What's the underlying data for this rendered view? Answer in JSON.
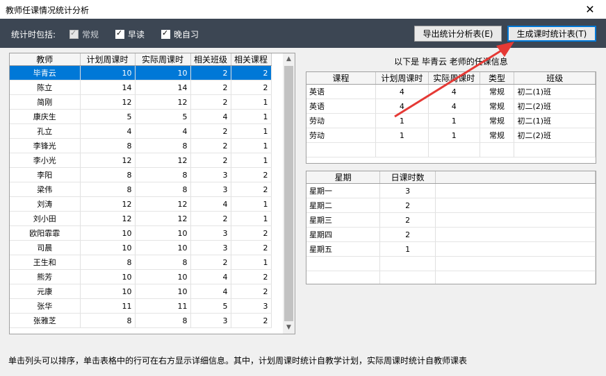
{
  "window": {
    "title": "教师任课情况统计分析",
    "close_glyph": "✕"
  },
  "toolbar": {
    "label": "统计时包括:",
    "checkboxes": [
      {
        "label": "常规",
        "checked": true,
        "disabled": true
      },
      {
        "label": "早读",
        "checked": true,
        "disabled": false
      },
      {
        "label": "晚自习",
        "checked": true,
        "disabled": false
      }
    ],
    "export_button": "导出统计分析表(E)",
    "generate_button": "生成课时统计表(T)"
  },
  "teacher_table": {
    "columns": [
      "教师",
      "计划周课时",
      "实际周课时",
      "相关班级",
      "相关课程"
    ],
    "selected_index": 0,
    "rows": [
      [
        "毕青云",
        "10",
        "10",
        "2",
        "2"
      ],
      [
        "陈立",
        "14",
        "14",
        "2",
        "2"
      ],
      [
        "简刚",
        "12",
        "12",
        "2",
        "1"
      ],
      [
        "康庆生",
        "5",
        "5",
        "4",
        "1"
      ],
      [
        "孔立",
        "4",
        "4",
        "2",
        "1"
      ],
      [
        "李锋光",
        "8",
        "8",
        "2",
        "1"
      ],
      [
        "李小光",
        "12",
        "12",
        "2",
        "1"
      ],
      [
        "李阳",
        "8",
        "8",
        "3",
        "2"
      ],
      [
        "梁伟",
        "8",
        "8",
        "3",
        "2"
      ],
      [
        "刘涛",
        "12",
        "12",
        "4",
        "1"
      ],
      [
        "刘小田",
        "12",
        "12",
        "2",
        "1"
      ],
      [
        "欧阳霏霏",
        "10",
        "10",
        "3",
        "2"
      ],
      [
        "司晨",
        "10",
        "10",
        "3",
        "2"
      ],
      [
        "王生和",
        "8",
        "8",
        "2",
        "1"
      ],
      [
        "熊芳",
        "10",
        "10",
        "4",
        "2"
      ],
      [
        "元康",
        "10",
        "10",
        "4",
        "2"
      ],
      [
        "张华",
        "11",
        "11",
        "5",
        "3"
      ],
      [
        "张雅芝",
        "8",
        "8",
        "3",
        "2"
      ]
    ]
  },
  "detail": {
    "caption": "以下是 毕青云 老师的任课信息",
    "course_columns": [
      "课程",
      "计划周课时",
      "实际周课时",
      "类型",
      "班级"
    ],
    "course_rows": [
      [
        "英语",
        "4",
        "4",
        "常规",
        "初二(1)班"
      ],
      [
        "英语",
        "4",
        "4",
        "常规",
        "初二(2)班"
      ],
      [
        "劳动",
        "1",
        "1",
        "常规",
        "初二(1)班"
      ],
      [
        "劳动",
        "1",
        "1",
        "常规",
        "初二(2)班"
      ]
    ],
    "day_columns": [
      "星期",
      "日课时数"
    ],
    "day_rows": [
      [
        "星期一",
        "3"
      ],
      [
        "星期二",
        "2"
      ],
      [
        "星期三",
        "2"
      ],
      [
        "星期四",
        "2"
      ],
      [
        "星期五",
        "1"
      ]
    ]
  },
  "annotation": {
    "arrow_color": "#e53935"
  },
  "status_text": "单击列头可以排序，单击表格中的行可在右方显示详细信息。其中，计划周课时统计自教学计划，实际周课时统计自教师课表"
}
